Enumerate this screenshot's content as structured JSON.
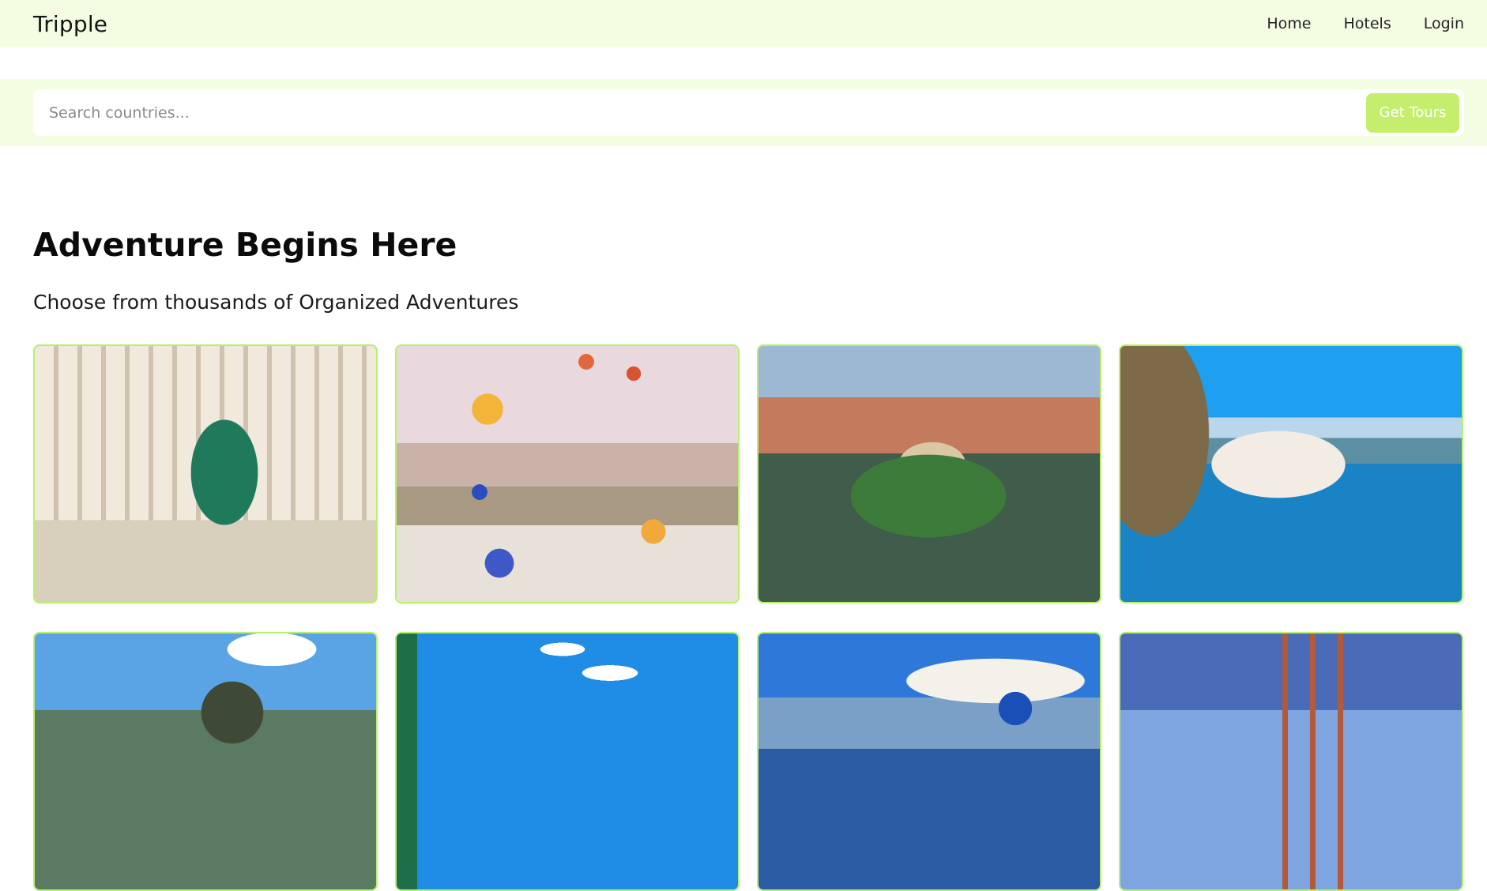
{
  "navbar": {
    "brand": "Tripple",
    "links": [
      {
        "label": "Home"
      },
      {
        "label": "Hotels"
      },
      {
        "label": "Login"
      }
    ]
  },
  "search": {
    "placeholder": "Search countries...",
    "value": "",
    "button_label": "Get Tours"
  },
  "hero": {
    "title": "Adventure Begins Here",
    "subtitle": "Choose from thousands of Organized Adventures"
  },
  "colors": {
    "nav_bg": "#f3fde2",
    "accent": "#c5ee6d",
    "card_border": "#b7f06a"
  }
}
